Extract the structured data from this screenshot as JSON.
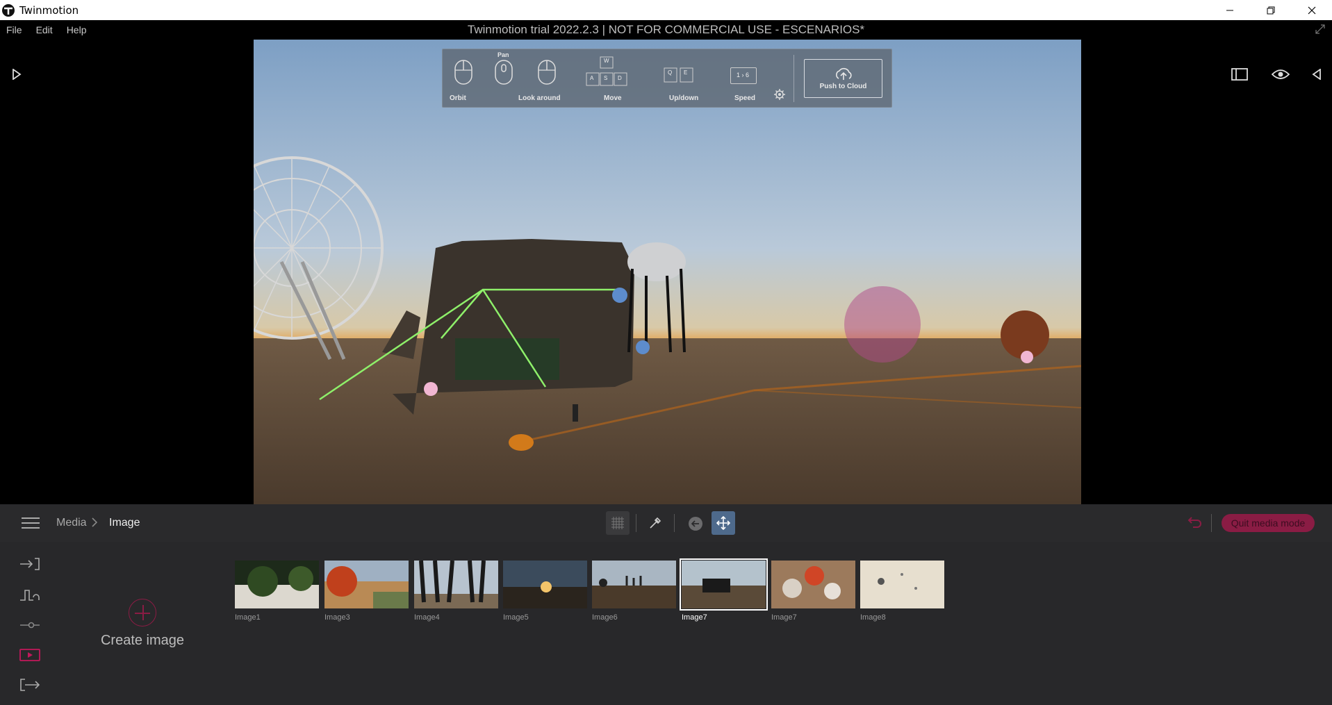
{
  "window": {
    "app_title": "Twinmotion",
    "document_title": "Twinmotion trial 2022.2.3 | NOT FOR COMMERCIAL USE - ESCENARIOS*"
  },
  "menu": [
    "File",
    "Edit",
    "Help"
  ],
  "nav_help": {
    "orbit": "Orbit",
    "pan": "Pan",
    "look_around": "Look around",
    "move": "Move",
    "up_down": "Up/down",
    "speed": "Speed",
    "speed_keys": "1 › 6",
    "keys_move": [
      "W",
      "A",
      "S",
      "D"
    ],
    "keys_updown": [
      "Q",
      "E"
    ],
    "push_to_cloud": "Push to Cloud"
  },
  "breadcrumb": {
    "root": "Media",
    "current": "Image"
  },
  "toolbar": {
    "quit_label": "Quit media mode"
  },
  "create": {
    "label": "Create image"
  },
  "thumbnails": [
    {
      "label": "Image1",
      "selected": false
    },
    {
      "label": "Image3",
      "selected": false
    },
    {
      "label": "Image4",
      "selected": false
    },
    {
      "label": "Image5",
      "selected": false
    },
    {
      "label": "Image6",
      "selected": false
    },
    {
      "label": "Image7",
      "selected": true
    },
    {
      "label": "Image7",
      "selected": false
    },
    {
      "label": "Image8",
      "selected": false
    }
  ],
  "colors": {
    "accent": "#8a1c44",
    "active_tool": "#4e6a8c"
  }
}
